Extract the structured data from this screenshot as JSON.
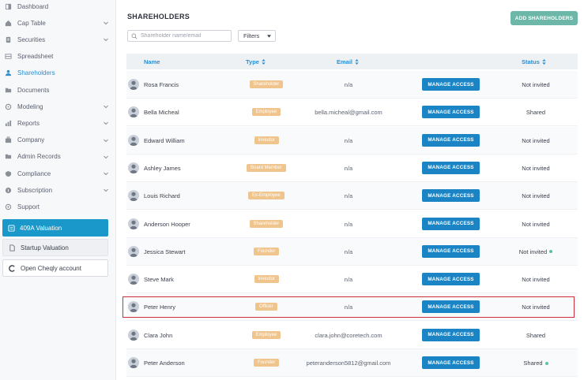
{
  "sidebar": {
    "items": [
      {
        "label": "Dashboard",
        "icon": "dashboard-icon",
        "chevron": false
      },
      {
        "label": "Cap Table",
        "icon": "cap-table-icon",
        "chevron": true
      },
      {
        "label": "Securities",
        "icon": "securities-icon",
        "chevron": true
      },
      {
        "label": "Spreadsheet",
        "icon": "spreadsheet-icon",
        "chevron": false
      },
      {
        "label": "Shareholders",
        "icon": "shareholders-icon",
        "chevron": false,
        "active": true
      },
      {
        "label": "Documents",
        "icon": "documents-icon",
        "chevron": false
      },
      {
        "label": "Modeling",
        "icon": "modeling-icon",
        "chevron": true
      },
      {
        "label": "Reports",
        "icon": "reports-icon",
        "chevron": true
      },
      {
        "label": "Company",
        "icon": "company-icon",
        "chevron": true
      },
      {
        "label": "Admin Records",
        "icon": "admin-records-icon",
        "chevron": true
      },
      {
        "label": "Compliance",
        "icon": "compliance-icon",
        "chevron": true
      },
      {
        "label": "Subscription",
        "icon": "subscription-icon",
        "chevron": true
      },
      {
        "label": "Support",
        "icon": "support-icon",
        "chevron": false
      }
    ],
    "cards": {
      "valuation_409a": "409A Valuation",
      "startup_valuation": "Startup Valuation",
      "open_account": "Open Cheqly account"
    }
  },
  "main": {
    "title": "SHAREHOLDERS",
    "add_button": "ADD SHAREHOLDERS",
    "search_placeholder": "Shareholder name/email",
    "filters_label": "Filters",
    "columns": {
      "name": "Name",
      "type": "Type",
      "email": "Email",
      "status": "Status"
    },
    "manage_label": "MANAGE ACCESS",
    "rows": [
      {
        "name": "Rosa Francis",
        "type": "Shareholder",
        "email": "n/a",
        "status": "Not invited",
        "dot": false
      },
      {
        "name": "Bella Micheal",
        "type": "Employee",
        "email": "bella.micheal@gmail.com",
        "status": "Shared",
        "dot": false
      },
      {
        "name": "Edward William",
        "type": "Investor",
        "email": "n/a",
        "status": "Not invited",
        "dot": false
      },
      {
        "name": "Ashley James",
        "type": "Board Member",
        "email": "n/a",
        "status": "Not invited",
        "dot": false
      },
      {
        "name": "Louis Richard",
        "type": "Ex-Employee",
        "email": "n/a",
        "status": "Not invited",
        "dot": false
      },
      {
        "name": "Anderson Hooper",
        "type": "Shareholder",
        "email": "n/a",
        "status": "Not invited",
        "dot": false
      },
      {
        "name": "Jessica Stewart",
        "type": "Founder",
        "email": "n/a",
        "status": "Not invited",
        "dot": true
      },
      {
        "name": "Steve Mark",
        "type": "Investor",
        "email": "n/a",
        "status": "Not invited",
        "dot": false
      },
      {
        "name": "Peter Henry",
        "type": "Officer",
        "email": "n/a",
        "status": "Not invited",
        "dot": false
      },
      {
        "name": "Clara John",
        "type": "Employee",
        "email": "clara.john@coretech.com",
        "status": "Shared",
        "dot": false
      },
      {
        "name": "Peter Anderson",
        "type": "Founder",
        "email": "peteranderson5812@gmail.com",
        "status": "Shared",
        "dot": true
      }
    ]
  },
  "colors": {
    "accent": "#1a84c4",
    "add_button": "#6db7a8",
    "badge": "#efc48d",
    "highlight": "#cf2f3a",
    "status_dot": "#5ebfa6"
  }
}
